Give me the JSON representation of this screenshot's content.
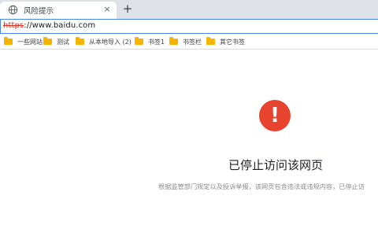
{
  "tab": {
    "favicon": "globe-icon",
    "title": "风险提示",
    "close": "×"
  },
  "new_tab": "+",
  "address_bar": {
    "scheme": "https",
    "rest": "://www.baidu.com",
    "scheme_color": "#d93025"
  },
  "bookmarks": [
    {
      "label": "一些网站",
      "icon": "folder-icon"
    },
    {
      "label": "测试",
      "icon": "folder-icon"
    },
    {
      "label": "从本地导入 (2)",
      "icon": "folder-icon"
    },
    {
      "label": "书签1",
      "icon": "folder-icon"
    },
    {
      "label": "书签栏",
      "icon": "folder-icon"
    },
    {
      "label": "其它书签",
      "icon": "folder-icon"
    }
  ],
  "page": {
    "icon": "exclamation-icon",
    "icon_glyph": "!",
    "icon_color": "#e8432e",
    "heading": "已停止访问该网页",
    "description": "根据监管部门规定以及投诉举报，该网页包含违法或违规内容，已停止访"
  }
}
